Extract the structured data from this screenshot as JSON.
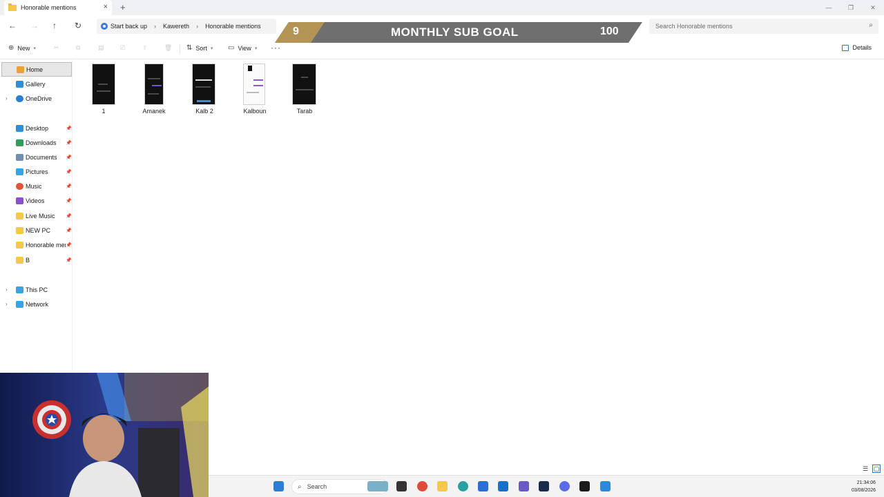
{
  "window": {
    "tab_title": "Honorable mentions",
    "new_tab": "+",
    "close": "×",
    "minimize": "—",
    "restore": "❐",
    "win_close": "✕"
  },
  "address": {
    "breadcrumbs": [
      "Start back up",
      "Kawereth",
      "Honorable mentions"
    ],
    "search_placeholder": "Search Honorable mentions"
  },
  "overlay": {
    "current": "9",
    "title": "MONTHLY SUB GOAL",
    "target": "100"
  },
  "toolbar": {
    "new_label": "New",
    "sort_label": "Sort",
    "view_label": "View",
    "more_label": "···",
    "details_label": "Details"
  },
  "sidebar": {
    "items": [
      {
        "label": "Home",
        "icon": "home-icon",
        "color": "#e8a23a"
      },
      {
        "label": "Gallery",
        "icon": "gallery-icon",
        "color": "#2f8fd8"
      },
      {
        "label": "OneDrive",
        "icon": "onedrive-icon",
        "color": "#2a7fd4"
      },
      {
        "label": "Desktop",
        "icon": "desktop-icon",
        "color": "#2f8fd8"
      },
      {
        "label": "Downloads",
        "icon": "download-icon",
        "color": "#2e9e5b"
      },
      {
        "label": "Documents",
        "icon": "documents-icon",
        "color": "#6f8fb3"
      },
      {
        "label": "Pictures",
        "icon": "pictures-icon",
        "color": "#3aa3e0"
      },
      {
        "label": "Music",
        "icon": "music-icon",
        "color": "#e0553a"
      },
      {
        "label": "Videos",
        "icon": "videos-icon",
        "color": "#8a4fd1"
      },
      {
        "label": "Live Music",
        "icon": "folder-icon",
        "color": "#f4c94a"
      },
      {
        "label": "NEW PC",
        "icon": "folder-icon",
        "color": "#f4c94a"
      },
      {
        "label": "Honorable ment",
        "icon": "folder-icon",
        "color": "#f4c94a"
      },
      {
        "label": "B",
        "icon": "folder-icon",
        "color": "#f4c94a"
      },
      {
        "label": "This PC",
        "icon": "pc-icon",
        "color": "#3aa3e0"
      },
      {
        "label": "Network",
        "icon": "network-icon",
        "color": "#3aa3e0"
      }
    ]
  },
  "files": [
    {
      "name": "1"
    },
    {
      "name": "Amanek"
    },
    {
      "name": "Kalb 2"
    },
    {
      "name": "Kalboun"
    },
    {
      "name": "Tarab"
    }
  ],
  "taskbar": {
    "search_label": "Search",
    "time": "21:34:06",
    "date": "03/08/2026"
  }
}
